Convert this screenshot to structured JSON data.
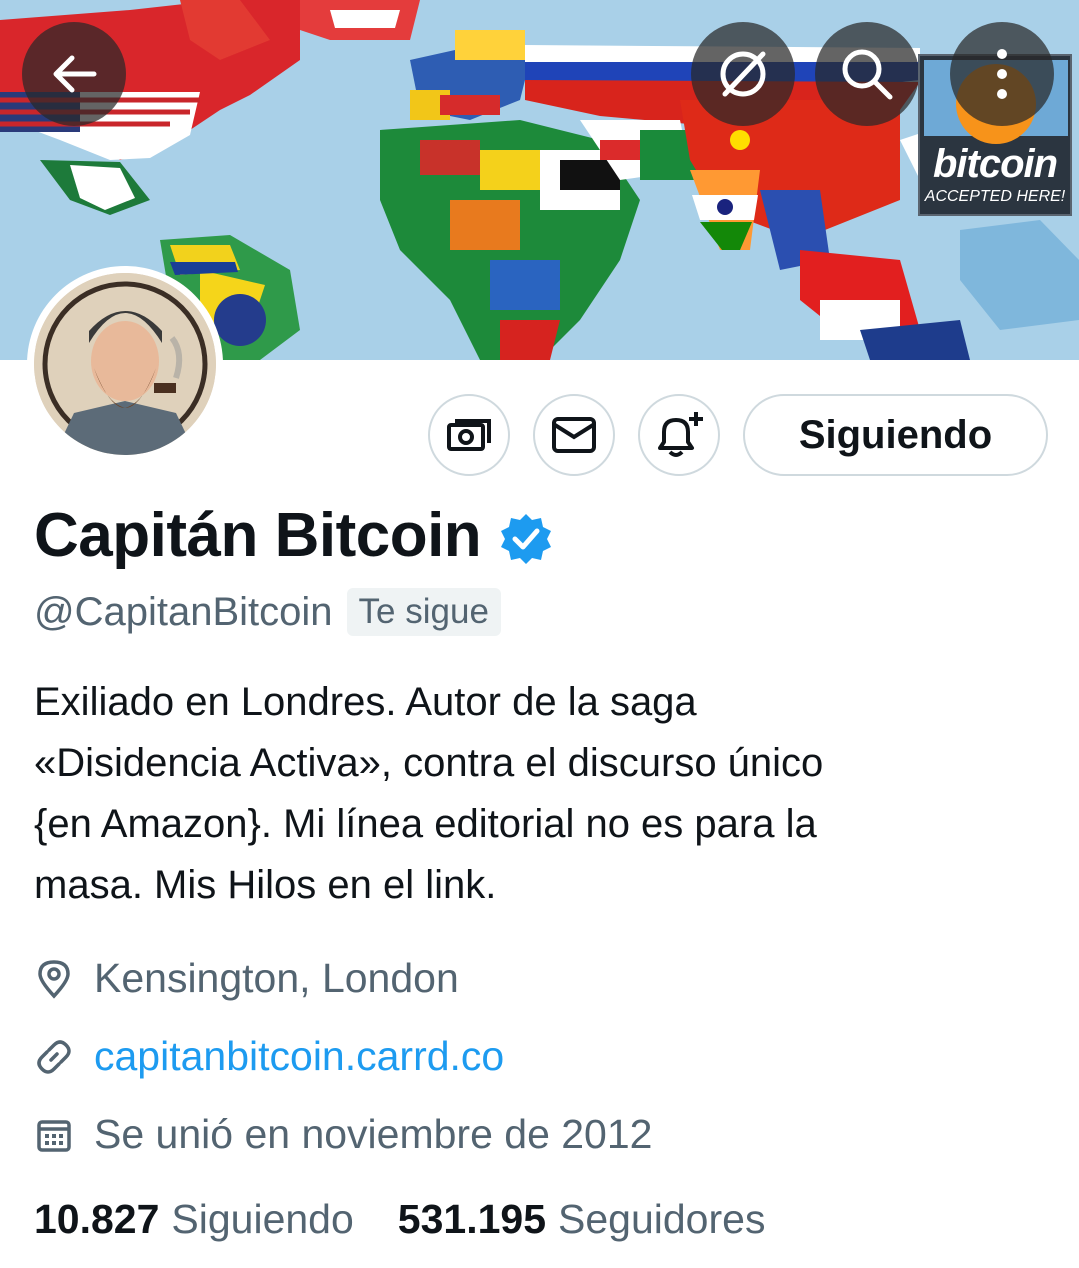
{
  "banner": {
    "badge_word": "bitcoin",
    "badge_sub": "ACCEPTED HERE!"
  },
  "header_icons": [
    "back-arrow-icon",
    "grok-icon",
    "search-icon",
    "more-vertical-icon"
  ],
  "actions": {
    "tip_icon": "money-icon",
    "message_icon": "envelope-icon",
    "notify_icon": "bell-plus-icon",
    "follow_label": "Siguiendo"
  },
  "profile": {
    "name": "Capitán Bitcoin",
    "handle": "@CapitanBitcoin",
    "follows_you": "Te sigue",
    "bio_lines": [
      "Exiliado en Londres. Autor de la saga",
      "«Disidencia Activa», contra el discurso único",
      "{en Amazon}. Mi línea editorial no es para la",
      "masa. Mis Hilos en el link."
    ],
    "location": "Kensington, London",
    "website": "capitanbitcoin.carrd.co",
    "joined": "Se unió en noviembre de 2012"
  },
  "stats": {
    "following_count": "10.827",
    "following_label": "Siguiendo",
    "followers_count": "531.195",
    "followers_label": "Seguidores"
  },
  "colors": {
    "text_primary": "#0f1419",
    "text_secondary": "#536471",
    "link": "#1d9bf0",
    "verified": "#1d9bf0",
    "border": "#cfd9de"
  }
}
